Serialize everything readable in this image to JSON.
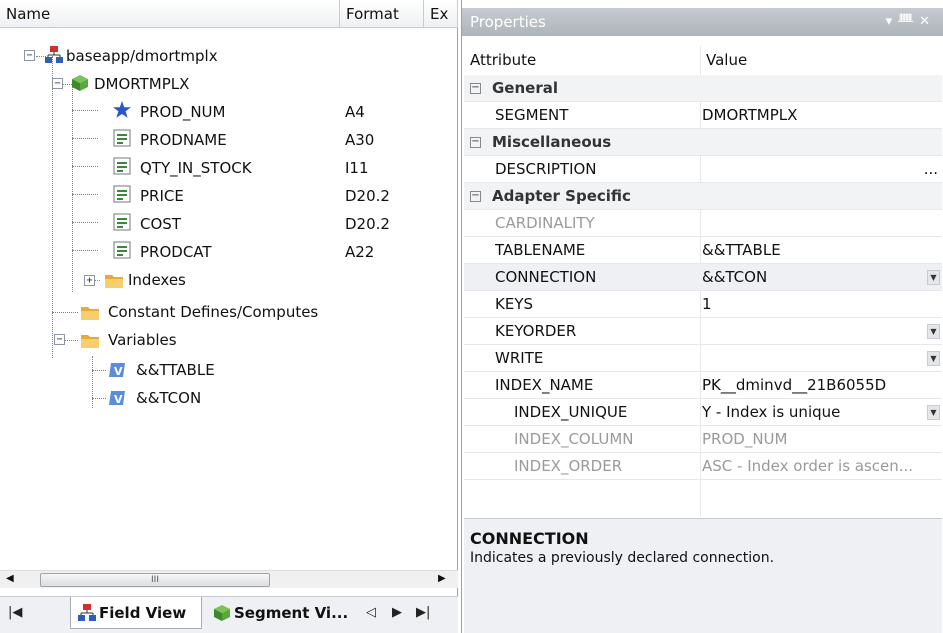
{
  "tree": {
    "columns": [
      "Name",
      "Format",
      "Ex"
    ],
    "rows": [
      {
        "label": "baseapp/dmortmplx",
        "format": ""
      },
      {
        "label": "DMORTMPLX",
        "format": ""
      },
      {
        "label": "PROD_NUM",
        "format": "A4"
      },
      {
        "label": "PRODNAME",
        "format": "A30"
      },
      {
        "label": "QTY_IN_STOCK",
        "format": "I11"
      },
      {
        "label": "PRICE",
        "format": "D20.2"
      },
      {
        "label": "COST",
        "format": "D20.2"
      },
      {
        "label": "PRODCAT",
        "format": "A22"
      },
      {
        "label": "Indexes",
        "format": ""
      },
      {
        "label": "Constant Defines/Computes",
        "format": ""
      },
      {
        "label": "Variables",
        "format": ""
      },
      {
        "label": "&&TTABLE",
        "format": ""
      },
      {
        "label": "&&TCON",
        "format": ""
      }
    ],
    "scroll_thumb": "III"
  },
  "tabs": {
    "field_view": "Field View",
    "segment_view": "Segment Vi..."
  },
  "properties": {
    "title": "Properties",
    "col_attribute": "Attribute",
    "col_value": "Value",
    "rows": [
      {
        "attr": "General",
        "value": "",
        "kind": "cat"
      },
      {
        "attr": "SEGMENT",
        "value": "DMORTMPLX",
        "kind": "prop"
      },
      {
        "attr": "Miscellaneous",
        "value": "",
        "kind": "cat"
      },
      {
        "attr": "DESCRIPTION",
        "value": "",
        "kind": "prop"
      },
      {
        "attr": "Adapter Specific",
        "value": "",
        "kind": "cat"
      },
      {
        "attr": "CARDINALITY",
        "value": "",
        "kind": "gray"
      },
      {
        "attr": "TABLENAME",
        "value": "&&TTABLE",
        "kind": "prop"
      },
      {
        "attr": "CONNECTION",
        "value": "&&TCON",
        "kind": "prop"
      },
      {
        "attr": "KEYS",
        "value": "1",
        "kind": "prop"
      },
      {
        "attr": "KEYORDER",
        "value": "",
        "kind": "prop"
      },
      {
        "attr": "WRITE",
        "value": "",
        "kind": "prop"
      },
      {
        "attr": "INDEX_NAME",
        "value": "PK__dminvd__21B6055D",
        "kind": "prop"
      },
      {
        "attr": "INDEX_UNIQUE",
        "value": "Y - Index is unique",
        "kind": "sub"
      },
      {
        "attr": "INDEX_COLUMN",
        "value": "PROD_NUM",
        "kind": "subgray"
      },
      {
        "attr": "INDEX_ORDER",
        "value": "ASC - Index order is ascen...",
        "kind": "subgray"
      }
    ],
    "ellipsis": "...",
    "desc_title": "CONNECTION",
    "desc_text": "Indicates a previously declared connection."
  }
}
